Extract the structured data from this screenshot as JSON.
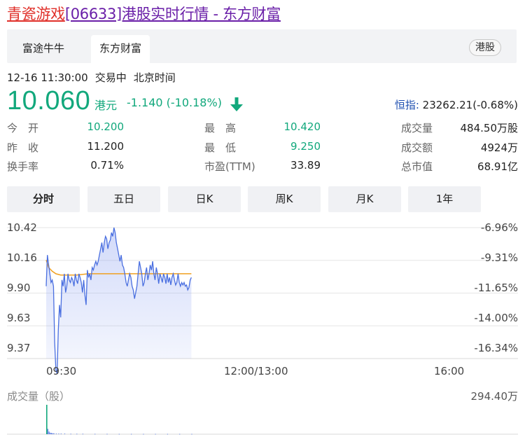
{
  "title": {
    "name_part": "青瓷游戏",
    "rest_part": "[06633]港股实时行情 - 东方财富"
  },
  "tabs": [
    {
      "label": "富途牛牛",
      "active": false
    },
    {
      "label": "东方财富",
      "active": true
    }
  ],
  "market_badge": "港股",
  "status": {
    "datetime": "12-16 11:30:00",
    "state": "交易中",
    "timezone": "北京时间"
  },
  "quote": {
    "price": "10.060",
    "currency": "港元",
    "change": "-1.140 (-10.18%)",
    "direction": "down",
    "color": "#12a87c"
  },
  "index": {
    "label": "恒指:",
    "value": "23262.21(-0.68%)"
  },
  "stats": [
    {
      "label": "今　开",
      "value": "10.200",
      "tone": "green"
    },
    {
      "label": "最　高",
      "value": "10.420",
      "tone": "green"
    },
    {
      "label": "成交量",
      "value": "484.50万股",
      "tone": "dark"
    },
    {
      "label": "昨　收",
      "value": "11.200",
      "tone": "dark"
    },
    {
      "label": "最　低",
      "value": "9.250",
      "tone": "green"
    },
    {
      "label": "成交额",
      "value": "4924万",
      "tone": "dark"
    },
    {
      "label": "换手率",
      "value": "0.71%",
      "tone": "dark"
    },
    {
      "label": "市盈(TTM)",
      "value": "33.89",
      "tone": "dark"
    },
    {
      "label": "总市值",
      "value": "68.91亿",
      "tone": "dark"
    }
  ],
  "periods": [
    {
      "label": "分时",
      "active": true
    },
    {
      "label": "五日",
      "active": false
    },
    {
      "label": "日K",
      "active": false
    },
    {
      "label": "周K",
      "active": false
    },
    {
      "label": "月K",
      "active": false
    },
    {
      "label": "1年",
      "active": false
    }
  ],
  "volume_label": "成交量（股）",
  "volume_max_label": "294.40万",
  "chart_data": {
    "type": "area",
    "title": "",
    "xlabel": "",
    "ylabel": "",
    "ylim": [
      9.37,
      10.42
    ],
    "y_ticks": [
      "10.42",
      "10.16",
      "9.90",
      "9.63",
      "9.37"
    ],
    "y_right_ticks": [
      "-6.96%",
      "-9.31%",
      "-11.65%",
      "-14.00%",
      "-16.34%"
    ],
    "x_ticks": [
      "09:30",
      "12:00/13:00",
      "16:00"
    ],
    "x_range_minutes": [
      0,
      390
    ],
    "grid": true,
    "series": [
      {
        "role": "price",
        "color": "#4a6fe0",
        "x": [
          0,
          1,
          2,
          3,
          4,
          5,
          6,
          7,
          8,
          9,
          10,
          11,
          12,
          13,
          14,
          15,
          16,
          17,
          18,
          19,
          20,
          21,
          22,
          23,
          24,
          25,
          26,
          27,
          28,
          29,
          30,
          31,
          32,
          33,
          34,
          35,
          36,
          37,
          38,
          39,
          40,
          41,
          42,
          43,
          44,
          45,
          46,
          47,
          48,
          49,
          50,
          51,
          52,
          53,
          54,
          55,
          56,
          57,
          58,
          59,
          60,
          61,
          62,
          63,
          64,
          65,
          66,
          67,
          68,
          69,
          70,
          71,
          72,
          73,
          74,
          75,
          76,
          77,
          78,
          79,
          80,
          81,
          82,
          83,
          84,
          85,
          86,
          87,
          88,
          89,
          90,
          91,
          92,
          93,
          94,
          95,
          96,
          97,
          98,
          99,
          100,
          101,
          102,
          103,
          104,
          105,
          106,
          107,
          108,
          109,
          110,
          111,
          112,
          113,
          114,
          115,
          116,
          117,
          118,
          119,
          120
        ],
        "values": [
          9.95,
          10.2,
          10.12,
          10.05,
          9.98,
          10.0,
          9.95,
          9.5,
          9.28,
          9.25,
          9.6,
          9.8,
          9.7,
          10.0,
          9.95,
          10.05,
          9.9,
          9.95,
          10.05,
          10.0,
          9.98,
          10.02,
          10.0,
          9.95,
          10.05,
          10.0,
          9.97,
          10.05,
          10.02,
          9.98,
          9.9,
          10.0,
          9.88,
          9.8,
          10.08,
          10.02,
          10.05,
          10.0,
          10.1,
          10.08,
          10.12,
          10.15,
          10.12,
          10.15,
          10.2,
          10.25,
          10.3,
          10.22,
          10.3,
          10.35,
          10.33,
          10.25,
          10.3,
          10.32,
          10.38,
          10.35,
          10.42,
          10.38,
          10.3,
          10.25,
          10.2,
          10.15,
          10.2,
          10.12,
          10.1,
          10.05,
          9.98,
          9.95,
          10.0,
          10.05,
          10.02,
          9.95,
          9.92,
          9.85,
          9.9,
          9.95,
          10.05,
          10.15,
          10.1,
          10.05,
          9.95,
          9.98,
          10.05,
          10.1,
          10.0,
          10.05,
          10.12,
          10.08,
          10.15,
          10.05,
          10.0,
          10.1,
          10.05,
          9.97,
          10.05,
          10.02,
          9.98,
          10.05,
          10.02,
          9.97,
          10.05,
          9.98,
          10.02,
          9.96,
          10.02,
          10.05,
          10.0,
          9.96,
          9.98,
          10.05,
          9.98,
          9.95,
          9.98,
          9.96,
          9.98,
          9.95,
          9.96,
          9.92,
          9.94,
          10.0,
          10.02
        ]
      },
      {
        "role": "average",
        "color": "#f0a020",
        "x": [
          0,
          2,
          5,
          8,
          12,
          18,
          25,
          35,
          50,
          70,
          90,
          110,
          120
        ],
        "values": [
          10.16,
          10.1,
          10.07,
          10.05,
          10.04,
          10.04,
          10.04,
          10.05,
          10.05,
          10.05,
          10.05,
          10.05,
          10.05
        ]
      }
    ],
    "volume": {
      "max": "294.40万",
      "x": [
        0,
        1,
        2,
        3,
        4,
        5,
        6,
        8,
        10,
        12,
        15,
        20,
        25,
        30,
        40,
        50,
        60,
        70,
        80,
        90,
        100,
        110,
        120
      ],
      "values": [
        100,
        18,
        9,
        5,
        4,
        3,
        3,
        2,
        2,
        2,
        2,
        1.5,
        1.5,
        1.5,
        1.2,
        1.2,
        1,
        1,
        1,
        1,
        1,
        1,
        1
      ]
    }
  }
}
